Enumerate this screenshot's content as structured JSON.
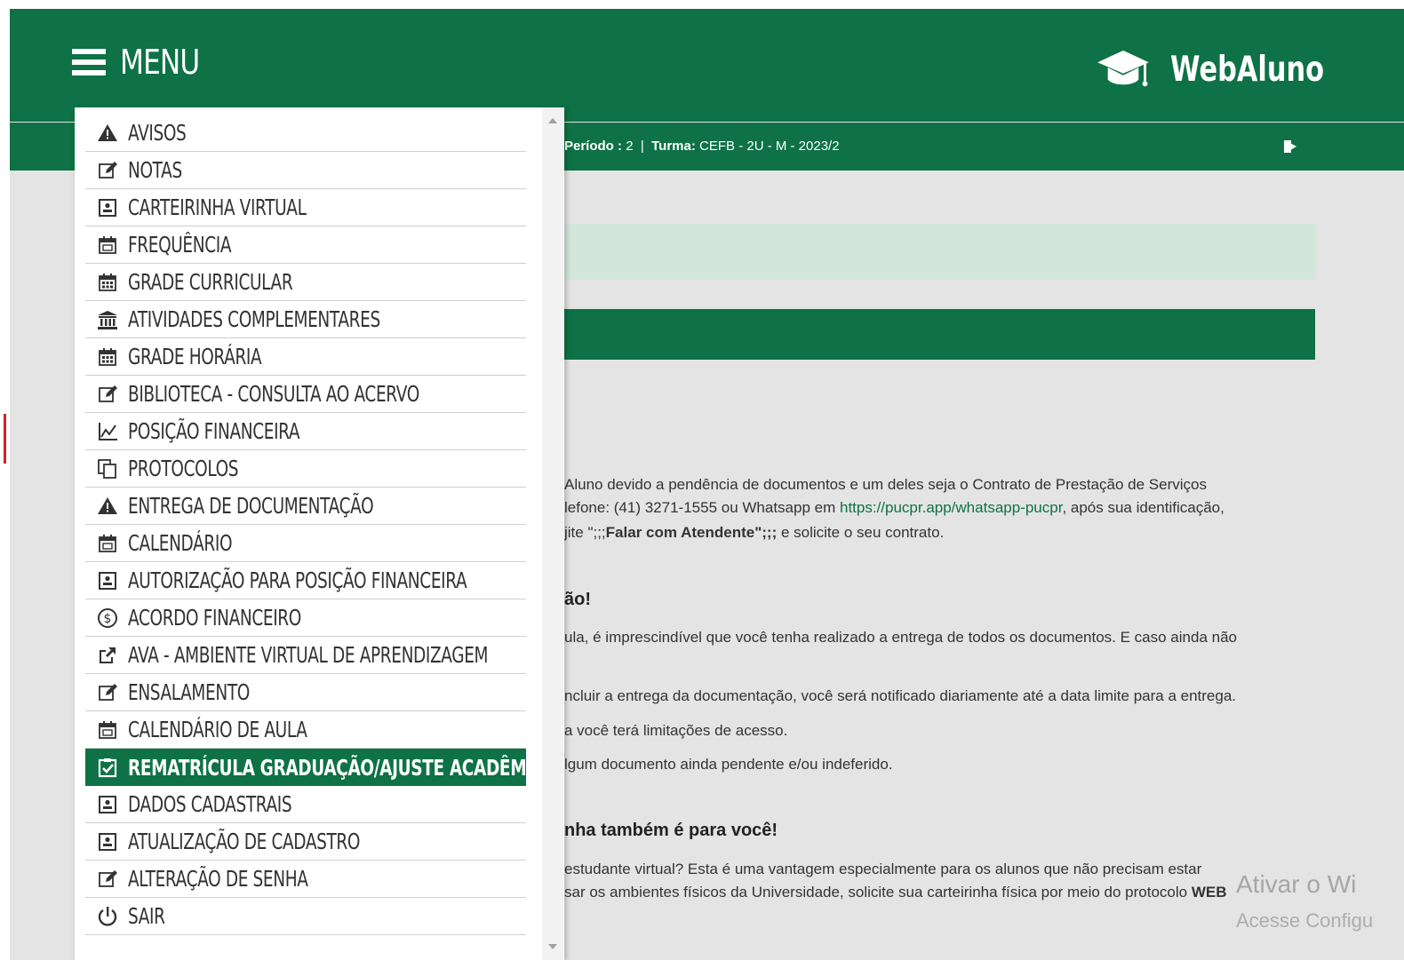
{
  "header": {
    "menu_label": "MENU",
    "brand_name": "WebAluno"
  },
  "infobar": {
    "periodo_label": "Período :",
    "periodo_value": "2",
    "turma_label": "Turma:",
    "turma_value": "CEFB - 2U - M - 2023/2"
  },
  "content": {
    "p1_line1": "Aluno devido a pendência de documentos e um deles seja o Contrato de Prestação de Serviços",
    "p1_line2_pre": "lefone: (41) 3271-1555 ou Whatsapp em ",
    "p1_link": "https://pucpr.app/whatsapp-pucpr",
    "p1_line2_post": ", após sua identificação,",
    "p1_line3_pre": "jite \";;;",
    "p1_line3_bold": "Falar com Atendente\";;;",
    "p1_line3_post": " e solicite o seu contrato.",
    "h2": "ão!",
    "p2_line1": "ula, é imprescindível que você tenha realizado a entrega de todos os documentos. E caso ainda não",
    "p2_line2": "ncluir a entrega da documentação, você será notificado diariamente até a data limite para a entrega.",
    "p2_line3": "a você terá limitações de acesso.",
    "p2_line4": "lgum documento ainda pendente e/ou indeferido.",
    "h3": "nha também é para você!",
    "p3_line1": "estudante virtual? Esta é uma vantagem especialmente para os alunos que não precisam estar",
    "p3_line2_pre": "sar os ambientes físicos da Universidade, solicite sua carteirinha física por meio do protocolo ",
    "p3_line2_bold": "WEB"
  },
  "watermark": {
    "line1": "Ativar o Wi",
    "line2": "Acesse Configu"
  },
  "menu": {
    "items": [
      {
        "label": "AVISOS",
        "icon": "warning-icon"
      },
      {
        "label": "NOTAS",
        "icon": "edit-icon"
      },
      {
        "label": "CARTEIRINHA VIRTUAL",
        "icon": "id-card-icon"
      },
      {
        "label": "FREQUÊNCIA",
        "icon": "calendar-icon"
      },
      {
        "label": "GRADE CURRICULAR",
        "icon": "calendar-grid-icon"
      },
      {
        "label": "ATIVIDADES COMPLEMENTARES",
        "icon": "institution-icon"
      },
      {
        "label": "GRADE HORÁRIA",
        "icon": "calendar-grid-icon"
      },
      {
        "label": "BIBLIOTECA - CONSULTA AO ACERVO",
        "icon": "edit-icon"
      },
      {
        "label": "POSIÇÃO FINANCEIRA",
        "icon": "line-chart-icon"
      },
      {
        "label": "PROTOCOLOS",
        "icon": "copy-icon"
      },
      {
        "label": "ENTREGA DE DOCUMENTAÇÃO",
        "icon": "warning-icon"
      },
      {
        "label": "CALENDÁRIO",
        "icon": "calendar-icon"
      },
      {
        "label": "AUTORIZAÇÃO PARA POSIÇÃO FINANCEIRA",
        "icon": "id-card-icon"
      },
      {
        "label": "ACORDO FINANCEIRO",
        "icon": "dollar-circle-icon"
      },
      {
        "label": "AVA - AMBIENTE VIRTUAL DE APRENDIZAGEM",
        "icon": "external-link-icon"
      },
      {
        "label": "ENSALAMENTO",
        "icon": "edit-icon"
      },
      {
        "label": "CALENDÁRIO DE AULA",
        "icon": "calendar-icon"
      },
      {
        "label": "REMATRÍCULA GRADUAÇÃO/AJUSTE ACADÊMICO",
        "icon": "clipboard-check-icon",
        "active": true
      },
      {
        "label": "DADOS CADASTRAIS",
        "icon": "id-card-icon"
      },
      {
        "label": "ATUALIZAÇÃO DE CADASTRO",
        "icon": "id-card-icon"
      },
      {
        "label": "ALTERAÇÃO DE SENHA",
        "icon": "edit-icon"
      },
      {
        "label": "SAIR",
        "icon": "power-icon"
      }
    ]
  },
  "colors": {
    "primary": "#0e7246",
    "alert_bg": "#d3e6dc",
    "page_bg": "#e4e4e4"
  }
}
